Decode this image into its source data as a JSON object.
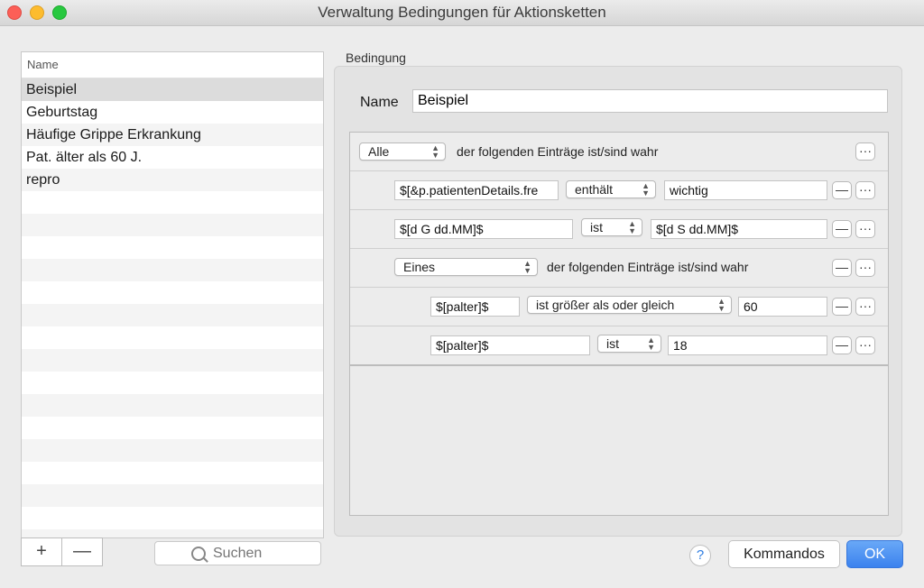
{
  "window": {
    "title": "Verwaltung Bedingungen für Aktionsketten"
  },
  "list": {
    "header": "Name",
    "items": [
      "Beispiel",
      "Geburtstag",
      "Häufige Grippe Erkrankung",
      "Pat. älter als 60 J.",
      "repro"
    ],
    "selected": "Beispiel",
    "add_label": "+",
    "remove_label": "—"
  },
  "search": {
    "placeholder": "Suchen",
    "value": ""
  },
  "detail": {
    "group_label": "Bedingung",
    "name_label": "Name",
    "name_value": "Beispiel",
    "conditions": [
      {
        "mode": "Alle",
        "text": "der folgenden Einträge ist/sind wahr"
      },
      {
        "field": "$[&p.patientenDetails.fre",
        "op": "enthält",
        "value": "wichtig"
      },
      {
        "field": "$[d G dd.MM]$",
        "op": "ist",
        "value": "$[d S dd.MM]$"
      },
      {
        "mode": "Eines",
        "text": "der folgenden Einträge ist/sind wahr"
      },
      {
        "field": "$[palter]$",
        "op": "ist größer als oder gleich",
        "value": "60"
      },
      {
        "field": "$[palter]$",
        "op": "ist",
        "value": "18"
      }
    ],
    "remove_symbol": "—",
    "more_symbol": "···"
  },
  "footer": {
    "help_label": "?",
    "kommandos_label": "Kommandos",
    "ok_label": "OK"
  },
  "colors": {
    "accent": "#3b82ee",
    "selected_row": "#dcdcdc"
  }
}
